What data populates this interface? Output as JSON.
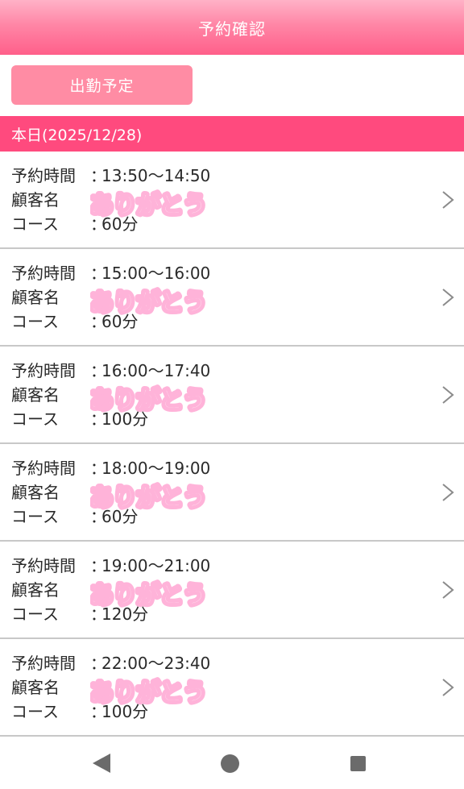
{
  "header": {
    "title": "予約確認"
  },
  "shift_button": {
    "label": "出勤予定"
  },
  "date_bar": {
    "text": "本日(2025/12/28)"
  },
  "labels": {
    "time": "予約時間",
    "customer": "顧客名",
    "course": "コース",
    "colon": "："
  },
  "sticker": {
    "text": "ありがとう",
    "fill": "#ffb3d9",
    "outline": "#ffffff",
    "color": "#ffffff"
  },
  "reservations": [
    {
      "time": "13:50〜14:50",
      "course": "60分"
    },
    {
      "time": "15:00〜16:00",
      "course": "60分"
    },
    {
      "time": "16:00〜17:40",
      "course": "100分"
    },
    {
      "time": "18:00〜19:00",
      "course": "60分"
    },
    {
      "time": "19:00〜21:00",
      "course": "120分"
    },
    {
      "time": "22:00〜23:40",
      "course": "100分"
    }
  ],
  "icons": {
    "row": "chevron-right-icon",
    "nav": [
      "back-icon",
      "home-icon",
      "recents-icon"
    ]
  },
  "colors": {
    "header_top": "#ffb2c7",
    "header_bottom": "#ff5f8a",
    "button": "#ff8ca4",
    "date_bar": "#ff4a7e",
    "divider": "#c8c8c8"
  }
}
